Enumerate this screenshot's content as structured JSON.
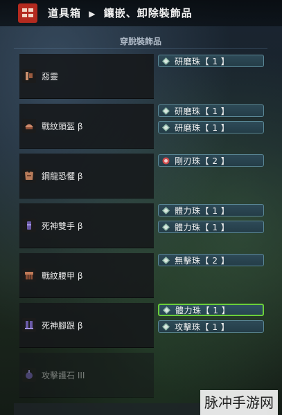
{
  "header": {
    "crumb_1": "道具箱",
    "crumb_2": "鑲嵌、卸除裝飾品"
  },
  "panel": {
    "title": "穿脫裝飾品"
  },
  "equipment": [
    {
      "name": "惡靈",
      "decorations": [
        "研磨珠【 1 】"
      ]
    },
    {
      "name": "戰紋頭盔 β",
      "decorations": [
        "研磨珠【 1 】",
        "研磨珠【 1 】"
      ]
    },
    {
      "name": "鋼龍恐懼 β",
      "decorations": [
        "剛刃珠【 2 】"
      ]
    },
    {
      "name": "死神雙手 β",
      "decorations": [
        "體力珠【 1 】",
        "體力珠【 1 】"
      ]
    },
    {
      "name": "戰紋腰甲 β",
      "decorations": [
        "無擊珠【 2 】"
      ]
    },
    {
      "name": "死神腳跟 β",
      "decorations": [
        "體力珠【 1 】",
        "攻擊珠【 1 】"
      ]
    },
    {
      "name": "攻擊護石 III",
      "decorations": []
    }
  ],
  "watermark": "脉冲手游网",
  "colors": {
    "slot_bg": "#2e4a57",
    "slot_border": "#5a8796",
    "selected_border": "#6bcf39",
    "header_logo": "#b42a1f"
  }
}
